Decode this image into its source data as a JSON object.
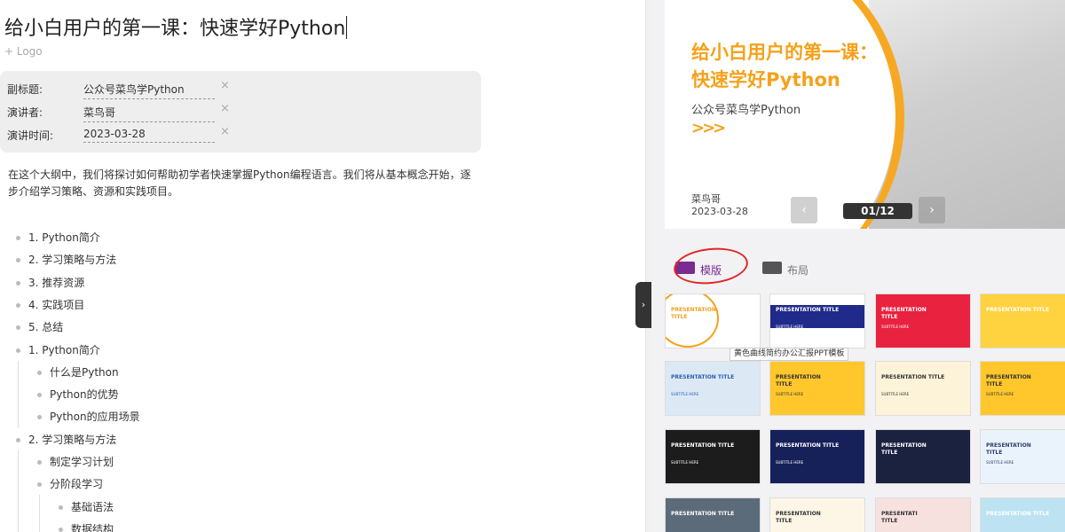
{
  "document": {
    "title": "给小白用户的第一课：快速学好Python",
    "add_logo": "+ Logo",
    "meta": [
      {
        "label": "副标题:",
        "value": "公众号菜鸟学Python"
      },
      {
        "label": "演讲者:",
        "value": "菜鸟哥"
      },
      {
        "label": "演讲时间:",
        "value": "2023-03-28"
      }
    ],
    "clear_icon": "×",
    "intro": "在这个大纲中，我们将探讨如何帮助初学者快速掌握Python编程语言。我们将从基本概念开始，逐步介绍学习策略、资源和实践项目。",
    "outline": [
      {
        "text": "1. Python简介",
        "level": 0
      },
      {
        "text": "2. 学习策略与方法",
        "level": 0
      },
      {
        "text": "3. 推荐资源",
        "level": 0
      },
      {
        "text": "4. 实践项目",
        "level": 0
      },
      {
        "text": "5. 总结",
        "level": 0
      },
      {
        "text": "1. Python简介",
        "level": 0
      },
      {
        "text": "什么是Python",
        "level": 1
      },
      {
        "text": "Python的优势",
        "level": 1
      },
      {
        "text": "Python的应用场景",
        "level": 1
      },
      {
        "text": "2. 学习策略与方法",
        "level": 0
      },
      {
        "text": "制定学习计划",
        "level": 1
      },
      {
        "text": "分阶段学习",
        "level": 1
      },
      {
        "text": "基础语法",
        "level": 2
      },
      {
        "text": "数据结构",
        "level": 2
      }
    ]
  },
  "panel_toggle": "›",
  "preview": {
    "title": "给小白用户的第一课：快速学好Python",
    "subtitle": "公众号菜鸟学Python",
    "arrows": ">>>",
    "author": "菜鸟哥",
    "date": "2023-03-28",
    "prev": "‹",
    "next": "›",
    "pager": "01/12"
  },
  "tabs": [
    {
      "label": "模版",
      "active": true
    },
    {
      "label": "布局",
      "active": false
    }
  ],
  "templates": {
    "tooltip": "黄色曲线简约办公汇报PPT模板",
    "items": [
      {
        "title": "PRESENTATION\nTITLE",
        "sub": "",
        "bg": "#ffffff",
        "fg": "#f5a11a"
      },
      {
        "title": "PRESENTATION TITLE",
        "sub": "SUBTITLE HERE",
        "bg": "#ffffff",
        "fg": "#ffffff"
      },
      {
        "title": "PRESENTATION\nTITLE",
        "sub": "SUBTITLE HERE",
        "bg": "#e8223f",
        "fg": "#ffffff"
      },
      {
        "title": "PRESENTATION TITLE",
        "sub": "",
        "bg": "#ffd23f",
        "fg": "#ffffff"
      },
      {
        "title": "PRESENTATION TITLE",
        "sub": "SUBTITLE HERE",
        "bg": "#dce9f5",
        "fg": "#2a5fb0"
      },
      {
        "title": "PRESENTATION\nTITLE",
        "sub": "SUBTITLE HERE",
        "bg": "#ffc72c",
        "fg": "#333333"
      },
      {
        "title": "PRESENTATION TITLE",
        "sub": "SUBTITLE HERE",
        "bg": "#fdf3d8",
        "fg": "#333333"
      },
      {
        "title": "PRESENTATION\nTITLE",
        "sub": "SUBTITLE HERE",
        "bg": "#ffc72c",
        "fg": "#333333"
      },
      {
        "title": "PRESENTATION TITLE",
        "sub": "SUBTITLE HERE",
        "bg": "#1c1c1c",
        "fg": "#ffffff"
      },
      {
        "title": "PRESENTATION TITLE",
        "sub": "SUBTITLE HERE",
        "bg": "#16215a",
        "fg": "#ffffff"
      },
      {
        "title": "PRESENTATION\nTITLE",
        "sub": "",
        "bg": "#1b2240",
        "fg": "#ffffff"
      },
      {
        "title": "PRESENTATION\nTITLE",
        "sub": "SUBTITLE HERE",
        "bg": "#eaf2fb",
        "fg": "#2b3f6b"
      },
      {
        "title": "PRESENTATION TITLE",
        "sub": "",
        "bg": "#5b6b7a",
        "fg": "#ffffff"
      },
      {
        "title": "PRESENTATION\nTITLE",
        "sub": "",
        "bg": "#fdf5e6",
        "fg": "#333333"
      },
      {
        "title": "PRESENTATI\nTITLE",
        "sub": "",
        "bg": "#f7e1df",
        "fg": "#333333"
      },
      {
        "title": "PRESENTATION TITLE",
        "sub": "",
        "bg": "#bde3f2",
        "fg": "#ffffff"
      }
    ]
  },
  "colors": {
    "accent": "#f5a11a",
    "tab_active": "#7b2a8f",
    "annotation": "#e32525"
  }
}
